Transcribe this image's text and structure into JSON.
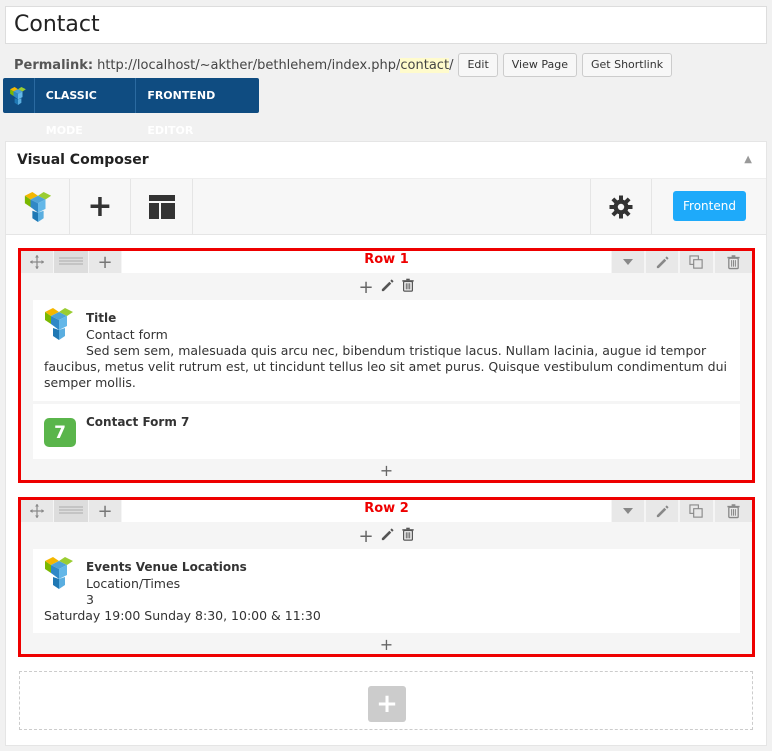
{
  "post": {
    "title": "Contact",
    "permalink_label": "Permalink:",
    "permalink_base": "http://localhost/~akther/bethlehem/index.php/",
    "permalink_slug": "contact",
    "permalink_trail": "/",
    "edit_label": "Edit",
    "view_label": "View Page",
    "shortlink_label": "Get Shortlink"
  },
  "modes": {
    "classic_label": "CLASSIC MODE",
    "frontend_label": "FRONTEND EDITOR"
  },
  "panel": {
    "title": "Visual Composer",
    "toggle_icon": "▲",
    "frontend_button": "Frontend"
  },
  "rows": [
    {
      "label": "Row 1",
      "elements": [
        {
          "title": "Title",
          "subtitle": "Contact form",
          "text": "Sed sem sem, malesuada quis arcu nec, bibendum tristique lacus. Nullam lacinia, augue id tempor faucibus, metus velit rutrum est, ut tincidunt tellus leo sit amet purus. Quisque vestibulum condimentum dui semper mollis."
        },
        {
          "title": "Contact Form 7",
          "badge": "7"
        }
      ]
    },
    {
      "label": "Row 2",
      "elements": [
        {
          "title": "Events Venue Locations",
          "subtitle": "Location/Times",
          "count": "3",
          "text": "Saturday 19:00 Sunday 8:30, 10:00 & 11:30"
        }
      ]
    }
  ],
  "icons": {
    "move": "move-icon",
    "layout": "column-layout-icon",
    "add": "plus-icon",
    "collapse": "chevron-down-icon",
    "edit": "pencil-icon",
    "clone": "clone-icon",
    "delete": "trash-icon",
    "settings": "gear-icon"
  },
  "colors": {
    "vc_blue": "#0f4c81",
    "frontend_blue": "#1eaafa",
    "row_highlight": "#e00000",
    "cf7_green": "#5ab54b"
  }
}
